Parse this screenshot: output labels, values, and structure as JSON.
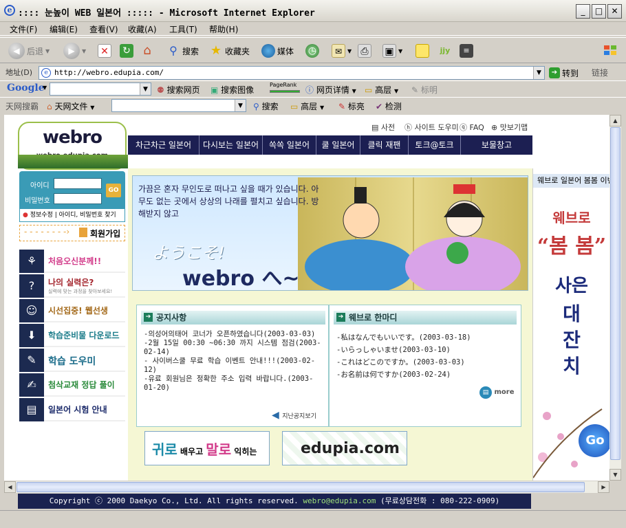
{
  "window": {
    "title": ":::: 눈높이 WEB 일본어 ::::: - Microsoft Internet Explorer",
    "min": "_",
    "max": "□",
    "close": "✕"
  },
  "menu": [
    "文件(F)",
    "编辑(E)",
    "查看(V)",
    "收藏(A)",
    "工具(T)",
    "帮助(H)"
  ],
  "toolbar": {
    "back": "后退",
    "search": "搜索",
    "favorites": "收藏夹",
    "media": "媒体"
  },
  "address": {
    "label": "地址(D)",
    "url": "http://webro.edupia.com/",
    "go": "转到",
    "links": "链接"
  },
  "google_bar": {
    "brand": "Google",
    "search_web": "搜索网页",
    "search_images": "搜索图像",
    "pagerank": "PageRank",
    "page_info": "网页详情",
    "highlight": "高层",
    "bookmark": "标明"
  },
  "tian_bar": {
    "brand": "天网搜霸",
    "files": "天网文件",
    "search": "搜索",
    "highlight": "高层",
    "mark": "标亮",
    "check": "检测"
  },
  "site": {
    "logo": "webro",
    "logo_url": "webro.edupia.com",
    "top_links": [
      "사전",
      "사이트 도우미",
      "FAQ",
      "맛보기맵"
    ],
    "nav": [
      "차근차근 일본어",
      "다시보는 일본어",
      "쏙쏙 일본어",
      "쿨 일본어",
      "클릭 재팬",
      "토크@토크",
      "보물창고"
    ],
    "login": {
      "id_label": "아이디",
      "pw_label": "비밀번호",
      "go": "GO",
      "links": "정보수정 | 아이디, 비밀번호 찾기",
      "join": "회원가입"
    },
    "side_menu": [
      {
        "label": "처음오신분께!!",
        "icon": "plant-icon"
      },
      {
        "label": "나의 실력은?",
        "sub": "실력에 맞는 과정을 찾아보세요!",
        "icon": "question-icon"
      },
      {
        "label": "시선집중! 웹선생",
        "icon": "people-icon"
      },
      {
        "label": "학습준비물 다운로드",
        "icon": "download-icon"
      },
      {
        "label": "학습 도우미",
        "icon": "pencil-icon"
      },
      {
        "label": "첨삭교재 정답 풀이",
        "icon": "hand-icon"
      },
      {
        "label": "일본어 시험 안내",
        "icon": "book-icon"
      }
    ],
    "hero": {
      "text": "가끔은 혼자 무인도로 떠나고 싶을 때가 있습니다. 아무도 없는 곳에서 상상의 나래를 펼치고 싶습니다. 방해받지 않고",
      "welcome": "ようこそ!",
      "brand": "webro へ~"
    },
    "notice": {
      "title": "공지사항",
      "items": [
        "-의성어의태어 코너가 오픈하였습니다(2003-03-03)",
        "-2월 15일 00:30 ~06:30 까지 시스템 점검(2003-02-14)",
        "- 사이버스쿨 무료 학습 이벤트 안내!!!(2003-02-12)",
        "-유료 회원님은 정확한 주소 입력 바랍니다.(2003-01-20)"
      ],
      "more": "지난공지보기"
    },
    "hitokoto": {
      "title": "웨브로 한마디",
      "items": [
        "-私はなんでもいいです。(2003-03-18)",
        "-いらっしゃいませ(2003-03-10)",
        "-これはどこのですか。(2003-03-03)",
        "-お名前は何ですか(2003-02-24)"
      ],
      "more": "more"
    },
    "banner1": {
      "a": "귀로",
      "b": " 배우고 ",
      "c": "말로",
      "d": " 익히는"
    },
    "banner2": "edupia.com",
    "right": {
      "title": "웨브로 일본어 봄봄 이벤트",
      "brand": "웨브로",
      "bom": "“봄 봄”",
      "line1": "사은",
      "line2": "대",
      "line3": "잔",
      "line4": "치",
      "go": "Go"
    },
    "footer": {
      "copy": "Copyright ⓒ 2000 Daekyo Co., Ltd. All rights reserved.",
      "email": "webro@edupia.com",
      "phone": "(무료상담전화 : 080-222-0909)"
    }
  },
  "colors": {
    "nav": "#1c1f52",
    "accent": "#9bbf4a",
    "login": "#3a9bb6"
  }
}
